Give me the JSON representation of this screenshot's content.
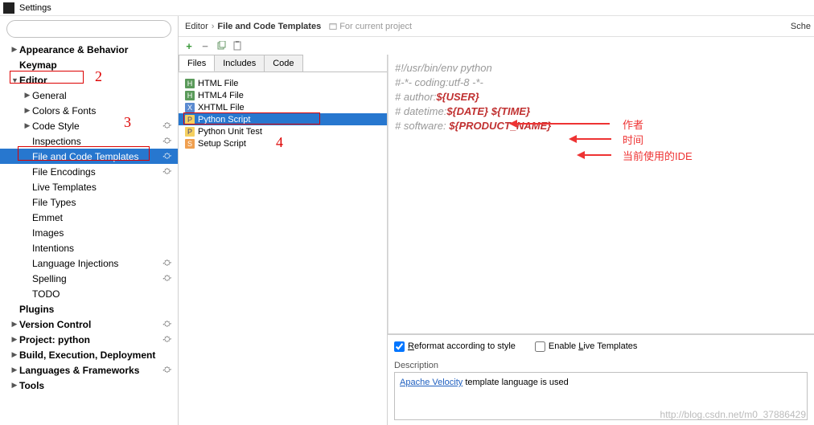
{
  "window": {
    "title": "Settings"
  },
  "search": {
    "placeholder": ""
  },
  "sidebar": {
    "items": [
      {
        "label": "Appearance & Behavior",
        "arrow": "▶",
        "level": 1,
        "bold": true
      },
      {
        "label": "Keymap",
        "arrow": "",
        "level": 1,
        "bold": true
      },
      {
        "label": "Editor",
        "arrow": "▼",
        "level": 1,
        "bold": true
      },
      {
        "label": "General",
        "arrow": "▶",
        "level": 2,
        "bold": false
      },
      {
        "label": "Colors & Fonts",
        "arrow": "▶",
        "level": 2,
        "bold": false
      },
      {
        "label": "Code Style",
        "arrow": "▶",
        "level": 2,
        "bold": false,
        "gear": true
      },
      {
        "label": "Inspections",
        "arrow": "",
        "level": 2,
        "bold": false,
        "gear": true
      },
      {
        "label": "File and Code Templates",
        "arrow": "",
        "level": 2,
        "bold": false,
        "gear": true,
        "selected": true
      },
      {
        "label": "File Encodings",
        "arrow": "",
        "level": 2,
        "bold": false,
        "gear": true
      },
      {
        "label": "Live Templates",
        "arrow": "",
        "level": 2,
        "bold": false
      },
      {
        "label": "File Types",
        "arrow": "",
        "level": 2,
        "bold": false
      },
      {
        "label": "Emmet",
        "arrow": "",
        "level": 2,
        "bold": false
      },
      {
        "label": "Images",
        "arrow": "",
        "level": 2,
        "bold": false
      },
      {
        "label": "Intentions",
        "arrow": "",
        "level": 2,
        "bold": false
      },
      {
        "label": "Language Injections",
        "arrow": "",
        "level": 2,
        "bold": false,
        "gear": true
      },
      {
        "label": "Spelling",
        "arrow": "",
        "level": 2,
        "bold": false,
        "gear": true
      },
      {
        "label": "TODO",
        "arrow": "",
        "level": 2,
        "bold": false
      },
      {
        "label": "Plugins",
        "arrow": "",
        "level": 1,
        "bold": true
      },
      {
        "label": "Version Control",
        "arrow": "▶",
        "level": 1,
        "bold": true,
        "gear": true
      },
      {
        "label": "Project: python",
        "arrow": "▶",
        "level": 1,
        "bold": true,
        "gear": true
      },
      {
        "label": "Build, Execution, Deployment",
        "arrow": "▶",
        "level": 1,
        "bold": true
      },
      {
        "label": "Languages & Frameworks",
        "arrow": "▶",
        "level": 1,
        "bold": true,
        "gear": true
      },
      {
        "label": "Tools",
        "arrow": "▶",
        "level": 1,
        "bold": true
      }
    ]
  },
  "breadcrumb": {
    "root": "Editor",
    "current": "File and Code Templates",
    "scope": "For current project",
    "right": "Sche"
  },
  "tabs": [
    {
      "label": "Files",
      "active": true
    },
    {
      "label": "Includes",
      "active": false
    },
    {
      "label": "Code",
      "active": false
    }
  ],
  "files": [
    {
      "label": "HTML File",
      "icon": "html"
    },
    {
      "label": "HTML4 File",
      "icon": "html"
    },
    {
      "label": "XHTML File",
      "icon": "xhtml"
    },
    {
      "label": "Python Script",
      "icon": "py",
      "selected": true
    },
    {
      "label": "Python Unit Test",
      "icon": "py"
    },
    {
      "label": "Setup Script",
      "icon": "setup"
    }
  ],
  "template": {
    "line1_a": "#!/usr/bin/env python",
    "line2_a": "#-*- coding:utf-8 -*-",
    "line3_a": "# author:",
    "line3_v": "${USER}",
    "line4_a": "# datetime:",
    "line4_v1": "${DATE}",
    "line4_v2": "${TIME}",
    "line5_a": "# software: ",
    "line5_v": "${PRODUCT_NAME}"
  },
  "annotations": {
    "n2": "2",
    "n3": "3",
    "n4": "4",
    "a_author": "作者",
    "a_time": "时间",
    "a_ide": "当前使用的IDE"
  },
  "options": {
    "reformat_pre": "R",
    "reformat": "eformat according to style",
    "live_pre": "Enable ",
    "live_u": "L",
    "live_post": "ive Templates"
  },
  "description": {
    "label": "Description",
    "link": "Apache Velocity",
    "rest": " template language is used"
  },
  "watermark": "http://blog.csdn.net/m0_37886429"
}
